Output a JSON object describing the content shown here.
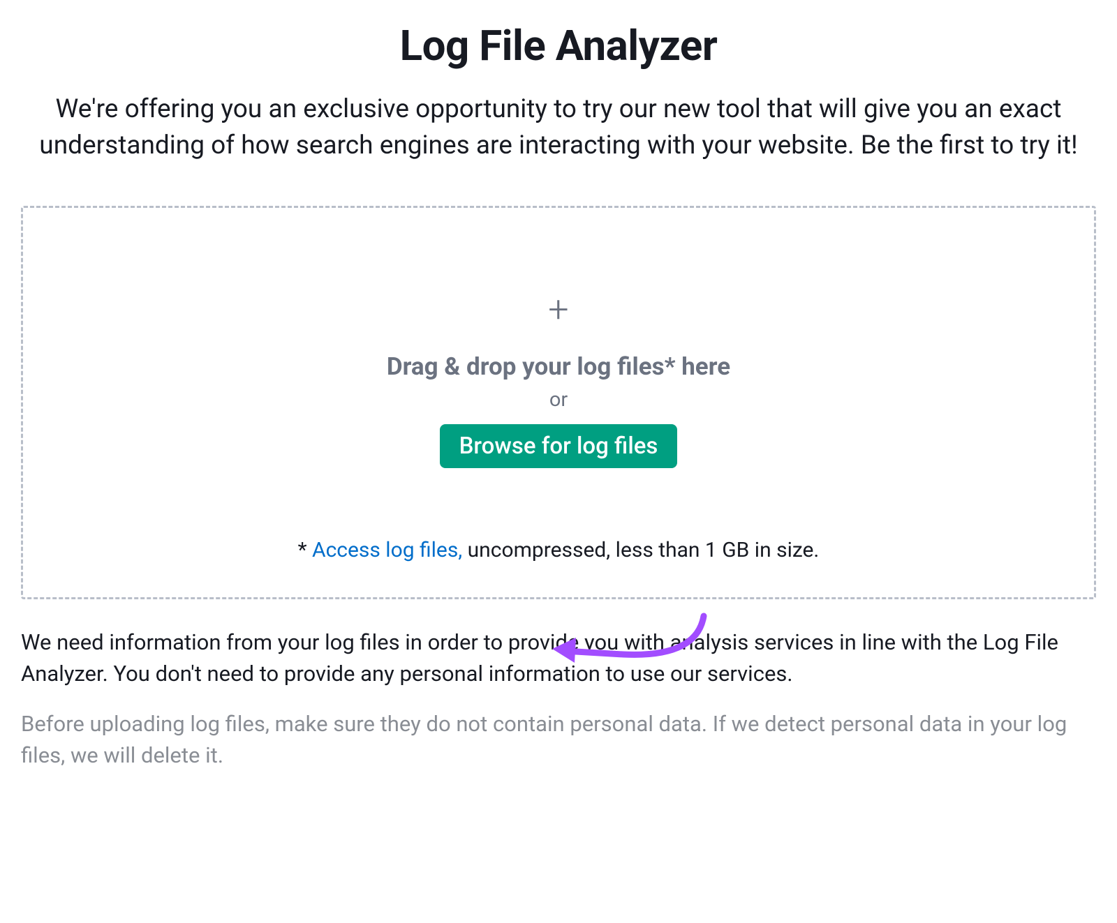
{
  "header": {
    "title": "Log File Analyzer",
    "subtitle": "We're offering you an exclusive opportunity to try our new tool that will give you an exact understanding of how search engines are interacting with your website. Be the first to try it!"
  },
  "dropzone": {
    "plus_glyph": "+",
    "drop_text": "Drag & drop your log files* here",
    "or_text": "or",
    "browse_button_label": "Browse for log files",
    "note_prefix": "* ",
    "note_link_text": "Access log files,",
    "note_rest": " uncompressed, less than 1 GB in size."
  },
  "info": {
    "primary": "We need information from your log files in order to provide you with analysis services in line with the Log File Analyzer. You don't need to provide any personal information to use our services.",
    "secondary": "Before uploading log files, make sure they do not contain personal data. If we detect personal data in your log files, we will delete it."
  },
  "colors": {
    "accent": "#009f81",
    "link": "#006dca",
    "annotation": "#a24dff"
  }
}
